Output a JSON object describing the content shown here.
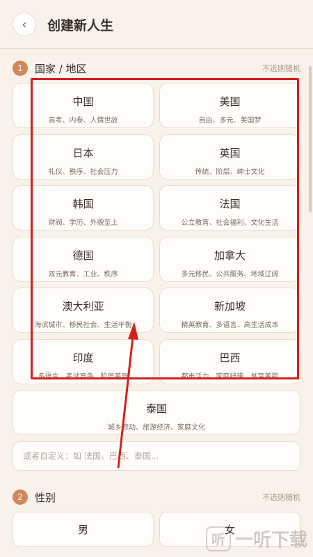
{
  "header": {
    "title": "创建新人生",
    "back_icon": "‹"
  },
  "section1": {
    "number": "1",
    "label": "国家 / 地区",
    "hint": "不选则随机"
  },
  "countries": [
    {
      "name": "中国",
      "desc": "高考、内卷、人情世故"
    },
    {
      "name": "美国",
      "desc": "自由、多元、美国梦"
    },
    {
      "name": "日本",
      "desc": "礼仪、秩序、社会压力"
    },
    {
      "name": "英国",
      "desc": "传统、阶层、绅士文化"
    },
    {
      "name": "韩国",
      "desc": "财阀、学历、外貌至上"
    },
    {
      "name": "法国",
      "desc": "公立教育、社会福利、文化生活"
    },
    {
      "name": "德国",
      "desc": "双元教育、工业、秩序"
    },
    {
      "name": "加拿大",
      "desc": "多元移民、公共服务、地域辽阔"
    },
    {
      "name": "澳大利亚",
      "desc": "海滨城市、移民社会、生活平衡"
    },
    {
      "name": "新加坡",
      "desc": "精英教育、多语言、高生活成本"
    },
    {
      "name": "印度",
      "desc": "多语言、考试竞争、阶层差异"
    },
    {
      "name": "巴西",
      "desc": "都市活力、家庭纽带、贫富差距"
    },
    {
      "name": "泰国",
      "desc": "城乡流动、旅游经济、家庭文化"
    }
  ],
  "custom": {
    "placeholder": "或者自定义：如 法国、巴西、泰国..."
  },
  "section2": {
    "number": "2",
    "label": "性别",
    "hint": "不选则随机"
  },
  "genders": [
    {
      "label": "男"
    },
    {
      "label": "女"
    }
  ],
  "watermark": {
    "logo": "听",
    "text": "一听下载"
  },
  "annotation": {
    "color": "#d51f1f"
  }
}
